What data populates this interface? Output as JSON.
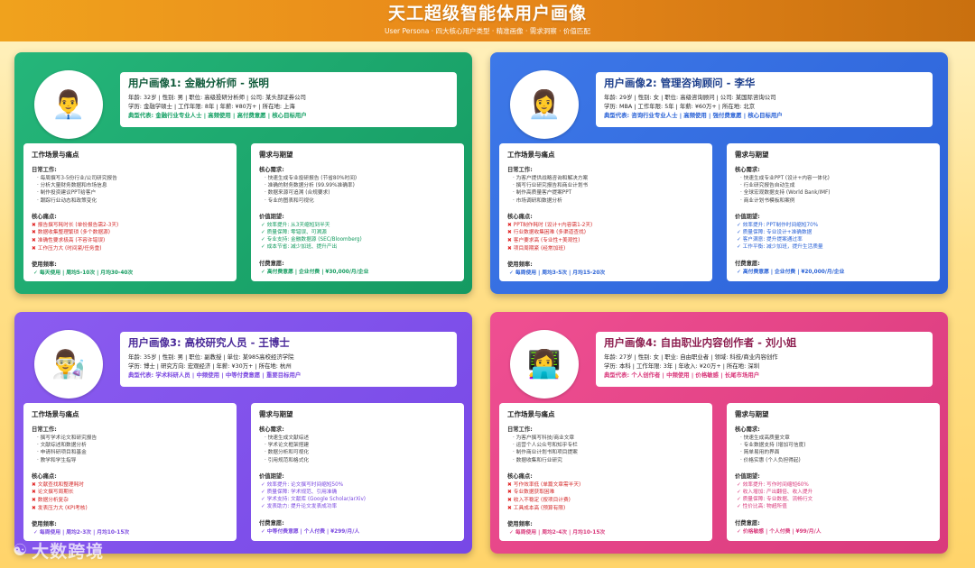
{
  "header": {
    "title": "天工超级智能体用户画像",
    "subtitle": "User Persona · 四大核心用户类型 · 精准画像 · 需求洞察 · 价值匹配"
  },
  "personas": [
    {
      "avatar": "👨‍💼",
      "title": "用户画像1: 金融分析师 - 张明",
      "line1": "年龄: 32岁 | 性别: 男 | 职位: 高级投研分析师 | 公司: 某头部证券公司",
      "line2": "学历: 金融学硕士 | 工作年限: 8年 | 年薪: ¥80万+ | 所在地: 上海",
      "tags": "典型代表: 金融行业专业人士 | 高频使用 | 高付费意愿 | 核心目标用户",
      "scene_title": "工作场景与痛点",
      "daily_label": "日常工作:",
      "daily": [
        "· 每周撰写3-5份行业/公司研究报告",
        "· 分析大量财务数据和市场信息",
        "· 制作投资建议PPT给客户",
        "· 跟踪行业动态和政策变化"
      ],
      "pain_label": "核心痛点:",
      "pains": [
        "报告撰写耗时长 (单份报告需2-3天)",
        "数据收集整理繁琐 (多个数据源)",
        "准确性要求极高 (不容许错误)",
        "工作压力大 (时间紧/任务重)"
      ],
      "freq_label": "使用频率:",
      "freq": "✓ 每天使用 | 周均5-10次 | 月均30-40次",
      "needs_title": "需求与期望",
      "core_label": "核心需求:",
      "core": [
        "· 快速生成专业投研报告 (节省80%时间)",
        "· 准确的财务数据分析 (99.99%准确率)",
        "· 数据来源可追溯 (合规要求)",
        "· 专业的图表和可视化"
      ],
      "value_label": "价值期望:",
      "values": [
        "✓ 效率提升: 从3天缩短到半天",
        "✓ 质量保障: 零错误、可溯源",
        "✓ 专业支持: 金融数据源 (SEC/Bloomberg)",
        "✓ 成本节省: 减少加班、提升产出"
      ],
      "pay_label": "付费意愿:",
      "pay": "✓ 高付费意愿 | 企业付费 | ¥30,000/月/企业"
    },
    {
      "avatar": "👩‍💼",
      "title": "用户画像2: 管理咨询顾问 - 李华",
      "line1": "年龄: 29岁 | 性别: 女 | 职位: 高级咨询顾问 | 公司: 某国际咨询公司",
      "line2": "学历: MBA | 工作年限: 5年 | 年薪: ¥60万+ | 所在地: 北京",
      "tags": "典型代表: 咨询行业专业人士 | 高频使用 | 强付费意愿 | 核心目标用户",
      "scene_title": "工作场景与痛点",
      "daily_label": "日常工作:",
      "daily": [
        "· 为客户提供战略咨询和解决方案",
        "· 撰写行业研究报告和商业计划书",
        "· 制作高质量客户提案PPT",
        "· 市场调研和数据分析"
      ],
      "pain_label": "核心痛点:",
      "pains": [
        "PPT制作耗时 (设计+内容需1-2天)",
        "行业数据收集困难 (多渠道查找)",
        "客户要求高 (专业性+美观性)",
        "项目周期紧 (经常加班)"
      ],
      "freq_label": "使用频率:",
      "freq": "✓ 每周使用 | 周均3-5次 | 月均15-20次",
      "needs_title": "需求与期望",
      "core_label": "核心需求:",
      "core": [
        "· 快速生成专业PPT (设计+内容一体化)",
        "· 行业研究报告自动生成",
        "· 全球宏观数据支持 (World Bank/IMF)",
        "· 商业计划书模板和案例"
      ],
      "value_label": "价值期望:",
      "values": [
        "✓ 效率提升: PPT制作时间缩短70%",
        "✓ 质量保障: 专业设计+准确数据",
        "✓ 客户满意: 提升提案通过率",
        "✓ 工作平衡: 减少加班，提升生活质量"
      ],
      "pay_label": "付费意愿:",
      "pay": "✓ 高付费意愿 | 企业付费 | ¥20,000/月/企业"
    },
    {
      "avatar": "👨‍🔬",
      "title": "用户画像3: 高校研究人员 - 王博士",
      "line1": "年龄: 35岁 | 性别: 男 | 职位: 副教授 | 单位: 某985高校经济学院",
      "line2": "学历: 博士 | 研究方向: 宏观经济 | 年薪: ¥30万+ | 所在地: 杭州",
      "tags": "典型代表: 学术科研人员 | 中频使用 | 中等付费意愿 | 重要目标用户",
      "scene_title": "工作场景与痛点",
      "daily_label": "日常工作:",
      "daily": [
        "· 撰写学术论文和研究报告",
        "· 文献综述和数据分析",
        "· 申请科研项目和基金",
        "· 教学和学生指导"
      ],
      "pain_label": "核心痛点:",
      "pains": [
        "文献查找和整理耗时",
        "论文撰写周期长",
        "数据分析复杂",
        "发表压力大 (KPI考核)"
      ],
      "freq_label": "使用频率:",
      "freq": "✓ 每周使用 | 周均2-3次 | 月均10-15次",
      "needs_title": "需求与期望",
      "core_label": "核心需求:",
      "core": [
        "· 快速生成文献综述",
        "· 学术论文框架搭建",
        "· 数据分析和可视化",
        "· 引用规范和格式化"
      ],
      "value_label": "价值期望:",
      "values": [
        "✓ 效率提升: 论文撰写时间缩短50%",
        "✓ 质量保障: 学术规范、引用准确",
        "✓ 学术支持: 文献库 (Google Scholar/arXiv)",
        "✓ 发表助力: 提升论文发表成功率"
      ],
      "pay_label": "付费意愿:",
      "pay": "✓ 中等付费意愿 | 个人付费 | ¥299/月/人"
    },
    {
      "avatar": "👩‍💻",
      "title": "用户画像4: 自由职业内容创作者 - 刘小姐",
      "line1": "年龄: 27岁 | 性别: 女 | 职业: 自由职业者 | 领域: 科技/商业内容创作",
      "line2": "学历: 本科 | 工作年限: 3年 | 年收入: ¥20万+ | 所在地: 深圳",
      "tags": "典型代表: 个人创作者 | 中频使用 | 价格敏感 | 长尾市场用户",
      "scene_title": "工作场景与痛点",
      "daily_label": "日常工作:",
      "daily": [
        "· 为客户撰写科技/商业文章",
        "· 运营个人公众号和知乎专栏",
        "· 制作商业计划书和项目提案",
        "· 数据收集和行业研究"
      ],
      "pain_label": "核心痛点:",
      "pains": [
        "写作效率低 (单篇文章需半天)",
        "专业数据获取困难",
        "收入不稳定 (按项目计费)",
        "工具成本高 (预算有限)"
      ],
      "freq_label": "使用频率:",
      "freq": "✓ 每周使用 | 周均2-4次 | 月均10-15次",
      "needs_title": "需求与期望",
      "core_label": "核心需求:",
      "core": [
        "· 快速生成高质量文章",
        "· 专业数据支持 (增加可信度)",
        "· 简单易用的界面",
        "· 价格实惠 (个人负担得起)"
      ],
      "value_label": "价值期望:",
      "values": [
        "✓ 效率提升: 写作时间缩短60%",
        "✓ 收入增加: 产出翻倍、收入提升",
        "✓ 质量保障: 专业数据、流畅行文",
        "✓ 性价比高: 物超所值"
      ],
      "pay_label": "付费意愿:",
      "pay": "✓ 价格敏感 | 个人付费 | ¥99/月/人"
    }
  ],
  "watermark": {
    "logo": "☯",
    "text": "大数跨境"
  }
}
